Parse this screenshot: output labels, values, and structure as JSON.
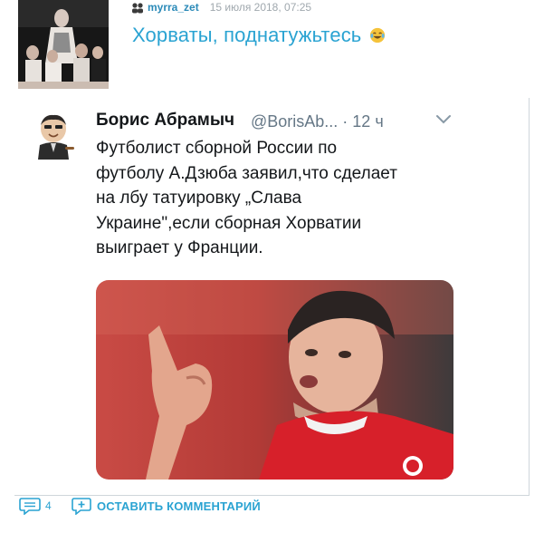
{
  "post": {
    "username": "myrra_zet",
    "date": "15 июля 2018, 07:25",
    "text": "Хорваты, поднатужьтесь"
  },
  "embedded_tweet": {
    "name": "Борис Абрамыч",
    "handle_time": "@BorisAb... · 12 ч",
    "body_lines": [
      "Футболист сборной России по",
      "футболу А.Дзюба заявил,что сделает",
      "на лбу татуировку „Слава",
      "Украине\",если сборная Хорватии",
      "выиграет у Франции."
    ]
  },
  "actions": {
    "comment_count": "4",
    "add_comment_label": "ОСТАВИТЬ КОММЕНТАРИЙ"
  },
  "colors": {
    "accent": "#2aa3d2",
    "username": "#2b8ab8",
    "meta": "#a0a8ae"
  }
}
